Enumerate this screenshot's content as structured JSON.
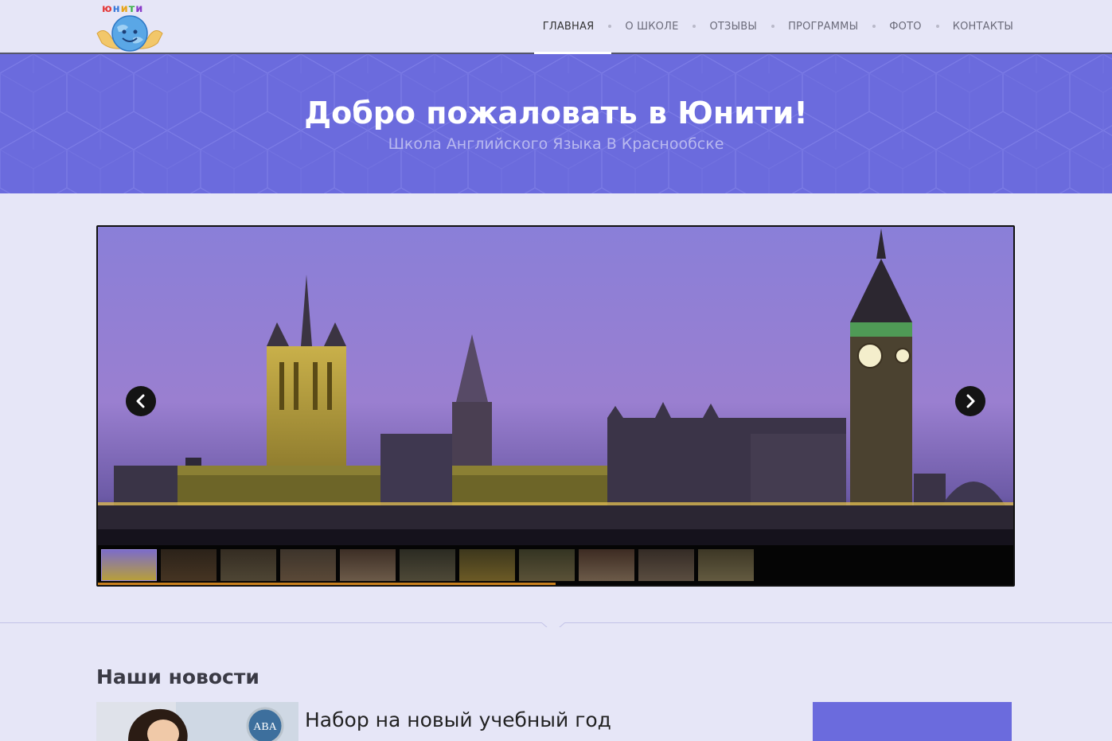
{
  "header": {
    "logo_text": [
      "ю",
      "н",
      "и",
      "т",
      "и"
    ],
    "nav": [
      {
        "label": "ГЛАВНАЯ",
        "active": true
      },
      {
        "label": "О ШКОЛЕ",
        "active": false
      },
      {
        "label": "ОТЗЫВЫ",
        "active": false
      },
      {
        "label": "ПРОГРАММЫ",
        "active": false
      },
      {
        "label": "ФОТО",
        "active": false
      },
      {
        "label": "КОНТАКТЫ",
        "active": false
      }
    ]
  },
  "hero": {
    "title": "Добро пожаловать в Юнити!",
    "subtitle": "Школа Английского Языка В Краснообске",
    "color": "#6b6bdd"
  },
  "slider": {
    "thumbnail_count": 11,
    "active_thumbnail": 1,
    "progress_fraction": 0.5,
    "prev_icon": "chevron-left-icon",
    "next_icon": "chevron-right-icon"
  },
  "news": {
    "section_title": "Наши новости",
    "items": [
      {
        "title": "Набор на новый учебный год",
        "badge": "ABA"
      }
    ]
  },
  "colors": {
    "accent": "#6b6bdd",
    "background": "#e6e6f7",
    "progress": "#c8801e"
  }
}
